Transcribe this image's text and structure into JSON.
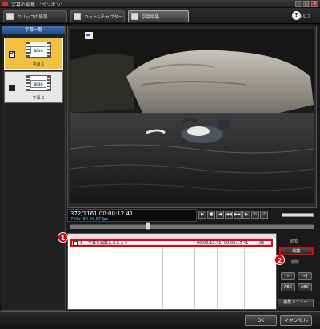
{
  "window": {
    "title": "字幕の編集 - 'ペンギン'"
  },
  "toolbar": {
    "tabs": [
      {
        "label": "クリップの情報"
      },
      {
        "label": "カット&チャプター"
      },
      {
        "label": "字幕編集"
      }
    ],
    "help_label": "ヘルプ"
  },
  "left_panel": {
    "title": "字幕一覧",
    "items": [
      {
        "label": "字幕 1",
        "thumb_text": "abc",
        "checked": true
      },
      {
        "label": "字幕 2",
        "thumb_text": "abc",
        "checked": false
      }
    ]
  },
  "player": {
    "frame_counter": "372/1161",
    "timecode": "00:00:12.41",
    "fps": "720x480 29.97 fps",
    "position_fraction": 0.32
  },
  "subtitle_list": {
    "rows": [
      {
        "index": "1",
        "text": "字幕を編集しましょう",
        "start": "00:00:12.41",
        "end": "00:00:17.41",
        "duration": "05"
      }
    ]
  },
  "right_panel": {
    "add_label": "追加",
    "edit_label": "編集",
    "delete_label": "削除",
    "abc_left": "ABC",
    "abc_right": "ABC",
    "edit_menu_label": "編集メニュー"
  },
  "callouts": {
    "first": "1",
    "second": "2"
  },
  "footer": {
    "ok_label": "OK",
    "cancel_label": "キャンセル"
  }
}
